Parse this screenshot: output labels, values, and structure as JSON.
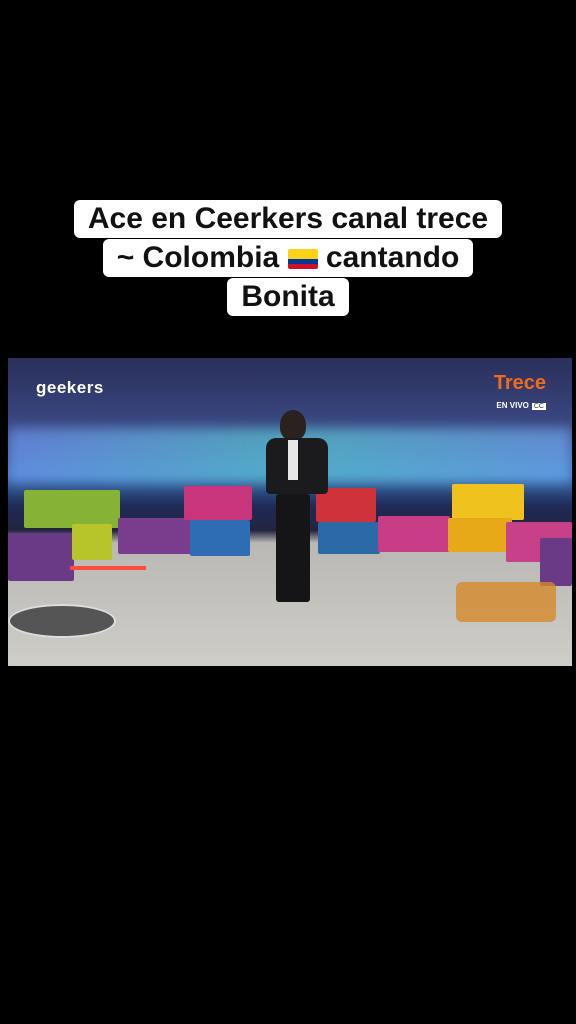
{
  "caption": {
    "line1": "Ace en Ceerkers canal trece",
    "line2_before": "~ Colombia",
    "line2_after": "cantando",
    "line3": "Bonita"
  },
  "video": {
    "logo_left": "geekers",
    "logo_right_brand": "Trece",
    "logo_right_live": "EN VIVO",
    "logo_right_cc": "CC"
  },
  "colors": {
    "background": "#000000",
    "caption_bg": "#ffffff",
    "flag_yellow": "#fcd116",
    "flag_blue": "#003893",
    "flag_red": "#ce1126"
  }
}
